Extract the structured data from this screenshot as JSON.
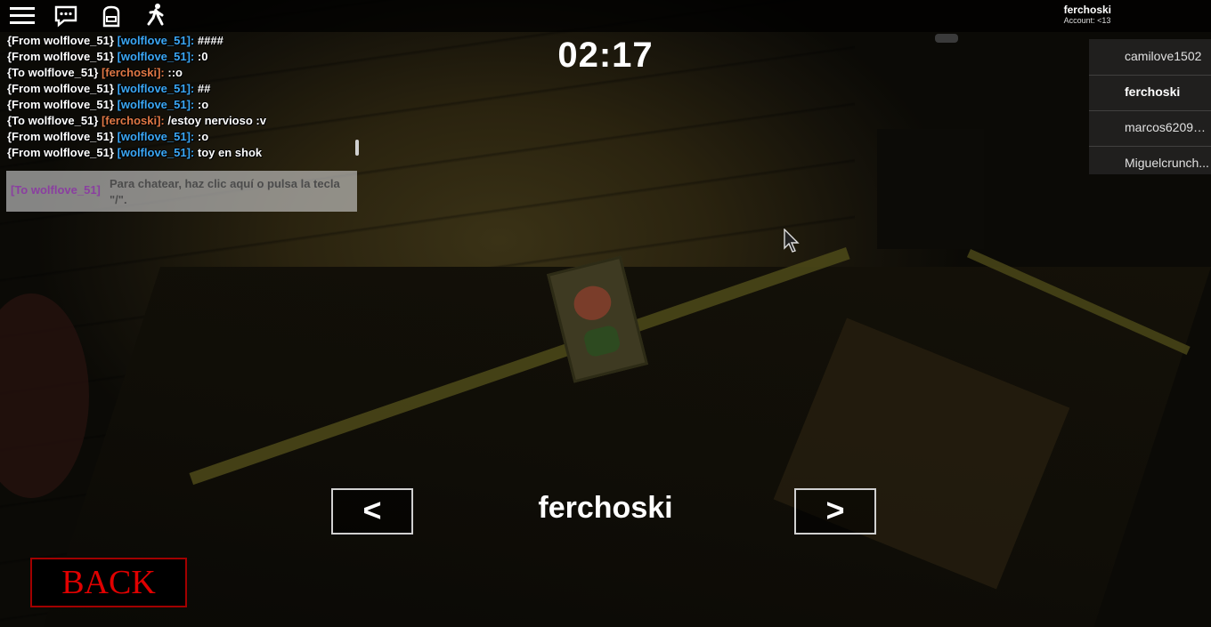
{
  "topbar": {
    "icons": [
      "menu-icon",
      "chat-icon",
      "backpack-icon",
      "emote-icon"
    ],
    "account_name": "ferchoski",
    "account_age": "Account: <13"
  },
  "chat": {
    "messages": [
      {
        "prefix": "{From wolflove_51}",
        "speaker": "[wolflove_51]:",
        "text": "####",
        "self": false
      },
      {
        "prefix": "{From wolflove_51}",
        "speaker": "[wolflove_51]:",
        "text": ":0",
        "self": false
      },
      {
        "prefix": "{To wolflove_51}",
        "speaker": "[ferchoski]:",
        "text": "::o",
        "self": true
      },
      {
        "prefix": "{From wolflove_51}",
        "speaker": "[wolflove_51]:",
        "text": "##",
        "self": false
      },
      {
        "prefix": "{From wolflove_51}",
        "speaker": "[wolflove_51]:",
        "text": ":o",
        "self": false
      },
      {
        "prefix": "{To wolflove_51}",
        "speaker": "[ferchoski]:",
        "text": "/estoy nervioso :v",
        "self": true
      },
      {
        "prefix": "{From wolflove_51}",
        "speaker": "[wolflove_51]:",
        "text": ":o",
        "self": false
      },
      {
        "prefix": "{From wolflove_51}",
        "speaker": "[wolflove_51]:",
        "text": "toy en shok",
        "self": false
      }
    ],
    "input_target": "[To wolflove_51]",
    "input_hint": "Para chatear, haz clic aquí o pulsa la tecla \"/\"."
  },
  "timer": "02:17",
  "players": [
    {
      "name": "camilove1502",
      "self": false
    },
    {
      "name": "ferchoski",
      "self": true
    },
    {
      "name": "marcos6209g...",
      "self": false
    },
    {
      "name": "Miguelcrunch...",
      "self": false
    }
  ],
  "spectate": {
    "prev_label": "<",
    "next_label": ">",
    "player_name": "ferchoski"
  },
  "back_label": "BACK",
  "colors": {
    "chat_other": "#3ba7f5",
    "chat_self": "#e07845",
    "whisper_target": "#8a3fa0",
    "back_red": "#e00000"
  }
}
